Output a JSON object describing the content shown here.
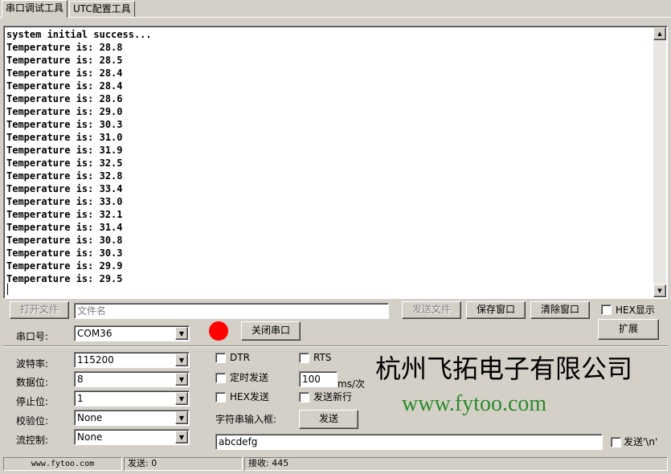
{
  "tabs": [
    {
      "label": "串口调试工具",
      "active": true
    },
    {
      "label": "UTC配置工具",
      "active": false
    }
  ],
  "terminal": {
    "lines": [
      "system initial success...",
      "Temperature is: 28.8",
      "Temperature is: 28.5",
      "Temperature is: 28.4",
      "Temperature is: 28.4",
      "Temperature is: 28.6",
      "Temperature is: 29.0",
      "Temperature is: 30.3",
      "Temperature is: 31.0",
      "Temperature is: 31.9",
      "Temperature is: 32.5",
      "Temperature is: 32.8",
      "Temperature is: 33.4",
      "Temperature is: 33.0",
      "Temperature is: 32.1",
      "Temperature is: 31.4",
      "Temperature is: 30.8",
      "Temperature is: 30.3",
      "Temperature is: 29.9",
      "Temperature is: 29.5"
    ]
  },
  "file_row": {
    "open_file_label": "打开文件",
    "filename_placeholder": "文件名",
    "send_file_label": "发送文件",
    "save_window_label": "保存窗口",
    "clear_window_label": "清除窗口",
    "hex_display_label": "HEX显示",
    "expand_label": "扩展"
  },
  "port": {
    "label": "串口号:",
    "value": "COM36",
    "indicator_color": "#ff0000",
    "close_port_label": "关闭串口"
  },
  "settings": {
    "baud_label": "波特率:",
    "baud_value": "115200",
    "databits_label": "数据位:",
    "databits_value": "8",
    "stopbits_label": "停止位:",
    "stopbits_value": "1",
    "parity_label": "校验位:",
    "parity_value": "None",
    "flow_label": "流控制:",
    "flow_value": "None"
  },
  "options": {
    "dtr_label": "DTR",
    "rts_label": "RTS",
    "timed_send_label": "定时发送",
    "interval_value": "100",
    "interval_unit": "ms/次",
    "hex_send_label": "HEX发送",
    "send_newline_label": "发送新行",
    "string_input_label": "字符串输入框:",
    "send_label": "发送",
    "string_input_value": "abcdefg",
    "send_crlf_label": "发送'\\n'"
  },
  "branding": {
    "company": "杭州飞拓电子有限公司",
    "url": "www.fytoo.com",
    "url_color": "#2a8a2a"
  },
  "status": {
    "site": "www.fytoo.com",
    "sent": "发送: 0",
    "received": "接收: 445"
  }
}
